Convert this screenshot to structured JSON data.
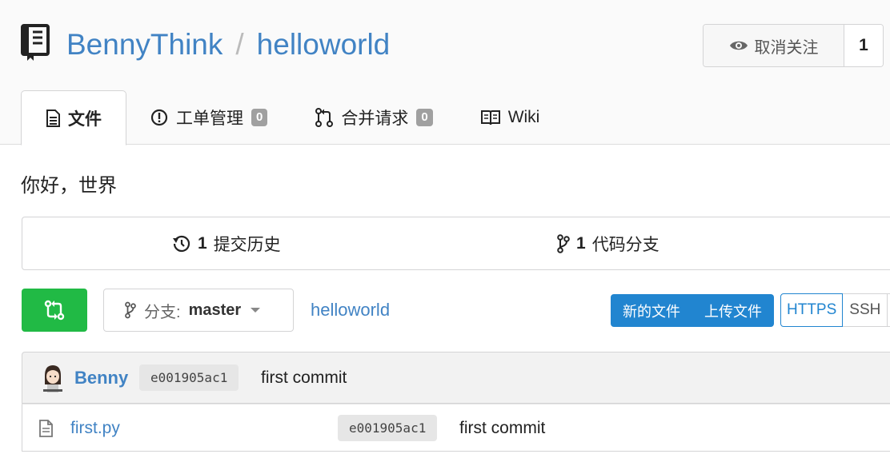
{
  "header": {
    "owner": "BennyThink",
    "separator": "/",
    "repo": "helloworld",
    "repo_icon": "book-icon",
    "watch": {
      "label": "取消关注",
      "icon": "eye-icon",
      "count": "1"
    }
  },
  "tabs": [
    {
      "label": "文件",
      "icon": "file-text-icon",
      "active": true
    },
    {
      "label": "工单管理",
      "icon": "issue-opened-icon",
      "badge": "0"
    },
    {
      "label": "合并请求",
      "icon": "git-pull-request-icon",
      "badge": "0"
    },
    {
      "label": "Wiki",
      "icon": "book-open-icon"
    }
  ],
  "description": "你好，世界",
  "stats": {
    "commits": {
      "count": "1",
      "label": "提交历史",
      "icon": "history-icon"
    },
    "branches": {
      "count": "1",
      "label": "代码分支",
      "icon": "git-branch-icon"
    }
  },
  "toolbar": {
    "compare_icon": "compare-icon",
    "branch_prefix": "分支:",
    "branch_name": "master",
    "breadcrumb": "helloworld",
    "new_file": "新的文件",
    "upload_file": "上传文件",
    "clone_https": "HTTPS",
    "clone_ssh": "SSH"
  },
  "latest_commit": {
    "author": "Benny",
    "sha": "e001905ac1",
    "message": "first commit"
  },
  "files": [
    {
      "name": "first.py",
      "icon": "file-icon",
      "sha": "e001905ac1",
      "message": "first commit"
    }
  ],
  "colors": {
    "link": "#4183c4",
    "primary": "#2185d0",
    "green": "#21ba45",
    "badge": "#a0a0a0"
  }
}
